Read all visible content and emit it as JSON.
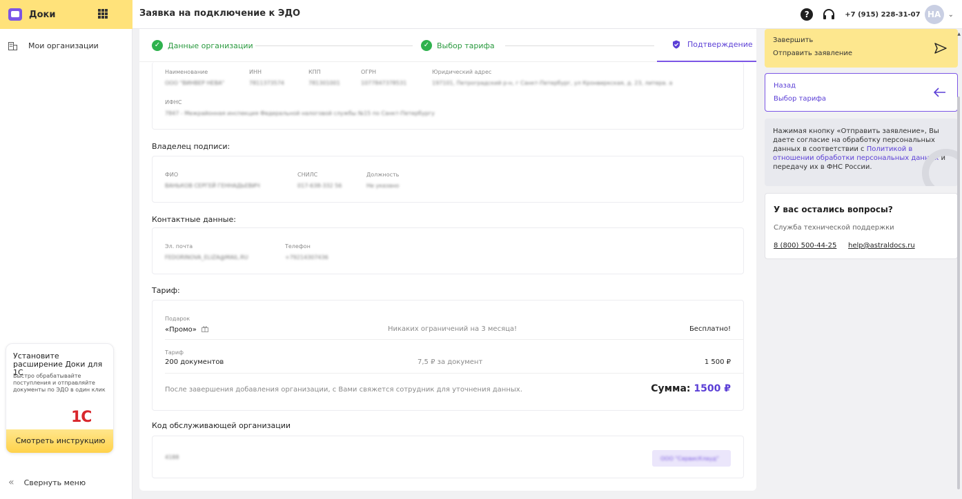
{
  "app": {
    "name": "Доки"
  },
  "header": {
    "title": "Заявка на подключение к ЭДО",
    "phone": "+7 (915) 228-31-07",
    "avatar": "НА"
  },
  "sidebar": {
    "items": [
      {
        "label": "Мои организации"
      }
    ],
    "promo": {
      "title": "Установите расширение Доки для 1С",
      "text": "Быстро обрабатывайте поступления и отправляйте документы по ЭДО в один клик",
      "logo": "1С",
      "button": "Смотреть инструкцию"
    },
    "collapse_label": "Свернуть меню"
  },
  "stepper": [
    {
      "label": "Данные организации",
      "state": "done"
    },
    {
      "label": "Выбор тарифа",
      "state": "done"
    },
    {
      "label": "Подтверждение",
      "state": "active"
    }
  ],
  "organization": {
    "labels": {
      "name": "Наименование",
      "inn": "ИНН",
      "kpp": "КПП",
      "ogrn": "ОГРН",
      "address": "Юридический адрес",
      "ifns": "ИФНС"
    },
    "values": {
      "name": "ООО \"ВИНВЕР НЕВА\"",
      "inn": "7811373574",
      "kpp": "781301001",
      "ogrn": "1077847378531",
      "address": "197101, Петроградский р-н, г Санкт-Петербург, ул Кронверкская, д. 23, литера. а",
      "ifns": "7847 - Межрайонная инспекция Федеральной налоговой службы №15 по Санкт-Петербургу"
    }
  },
  "owner": {
    "title": "Владелец подписи:",
    "labels": {
      "fio": "ФИО",
      "snils": "СНИЛС",
      "position": "Должность"
    },
    "values": {
      "fio": "ВАНЬКОВ СЕРГЕЙ ГЕННАДЬЕВИЧ",
      "snils": "017-638-332 56",
      "position": "Не указано"
    }
  },
  "contacts": {
    "title": "Контактные данные:",
    "labels": {
      "email": "Эл. почта",
      "phone": "Телефон"
    },
    "values": {
      "email": "FEDORINOVA_ELIZA@MAIL.RU",
      "phone": "+79214307436"
    }
  },
  "tariff": {
    "title": "Тариф:",
    "gift": {
      "label": "Подарок",
      "name": "«Промо»",
      "desc": "Никаких ограничений на 3 месяца!",
      "price": "Бесплатно!"
    },
    "plan": {
      "label": "Тариф",
      "name": "200 документов",
      "desc": "7,5 ₽ за документ",
      "price": "1 500 ₽"
    },
    "note": "После завершения добавления организации, с Вами свяжется сотрудник для уточнения данных.",
    "sum_label": "Сумма:",
    "sum_value": "1500 ₽"
  },
  "service_org": {
    "title": "Код обслуживающей организации",
    "code": "4188",
    "name": "ООО \"СервисКлауд\""
  },
  "right_panel": {
    "finish": {
      "line1": "Завершить",
      "line2": "Отправить заявление"
    },
    "back": {
      "line1": "Назад",
      "line2": "Выбор тарифа"
    },
    "consent": {
      "before": "Нажимая кнопку «Отправить заявление», Вы даете согласие на обработку персональных данных в соответствии с ",
      "link": "Политикой в отношении обработки персональных данных",
      "after": " и передачу их в ФНС России."
    },
    "support": {
      "title": "У вас остались вопросы?",
      "subtitle": "Служба технической поддержки",
      "phone": "8 (800) 500-44-25",
      "email": "help@astraldocs.ru"
    }
  },
  "colors": {
    "accent": "#7b55e6",
    "brand_yellow": "#ffe27a",
    "success": "#2fb24e"
  }
}
